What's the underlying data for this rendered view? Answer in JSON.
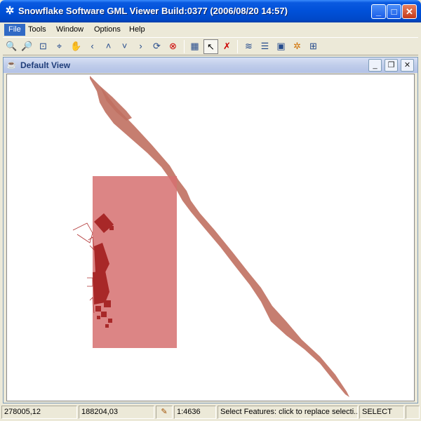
{
  "window": {
    "title": "Snowflake Software GML Viewer Build:0377 (2006/08/20 14:57)",
    "app_icon": "snowflake-icon",
    "controls": {
      "minimize": "_",
      "maximize": "□",
      "close": "✕"
    }
  },
  "menu": {
    "items": [
      "File",
      "Tools",
      "Window",
      "Options",
      "Help"
    ],
    "active": "File"
  },
  "toolbar": {
    "tools": [
      {
        "name": "zoom-in-icon",
        "glyph": "🔍"
      },
      {
        "name": "zoom-out-icon",
        "glyph": "🔎"
      },
      {
        "name": "zoom-box-icon",
        "glyph": "⊡"
      },
      {
        "name": "zoom-extent-icon",
        "glyph": "⌖"
      },
      {
        "name": "pan-hand-icon",
        "glyph": "✋"
      },
      {
        "name": "pan-left-icon",
        "glyph": "‹"
      },
      {
        "name": "pan-up-icon",
        "glyph": "˄"
      },
      {
        "name": "pan-down-icon",
        "glyph": "˅"
      },
      {
        "name": "pan-right-icon",
        "glyph": "›"
      },
      {
        "name": "refresh-icon",
        "glyph": "⟳"
      },
      {
        "name": "stop-icon",
        "glyph": "⊗"
      },
      {
        "name": "grid-icon",
        "glyph": "▦"
      },
      {
        "name": "select-arrow-icon",
        "glyph": "↖"
      },
      {
        "name": "deselect-icon",
        "glyph": "✗"
      },
      {
        "name": "layers-icon",
        "glyph": "≋"
      },
      {
        "name": "properties-list-icon",
        "glyph": "☰"
      },
      {
        "name": "feature-icon",
        "glyph": "▣"
      },
      {
        "name": "settings-icon",
        "glyph": "✲"
      },
      {
        "name": "add-view-icon",
        "glyph": "⊞"
      }
    ]
  },
  "view": {
    "title": "Default View",
    "icon": "java-cup-icon"
  },
  "colors": {
    "feature_fill": "#c07060",
    "selection_fill": "#d67070",
    "building_fill": "#b03030"
  },
  "status": {
    "x_coord": "278005,12",
    "y_coord": "188204,03",
    "scale": "1:4636",
    "message": "Select Features: click to replace selecti...",
    "mode": "SELECT",
    "edit_icon": "pencil-icon"
  }
}
